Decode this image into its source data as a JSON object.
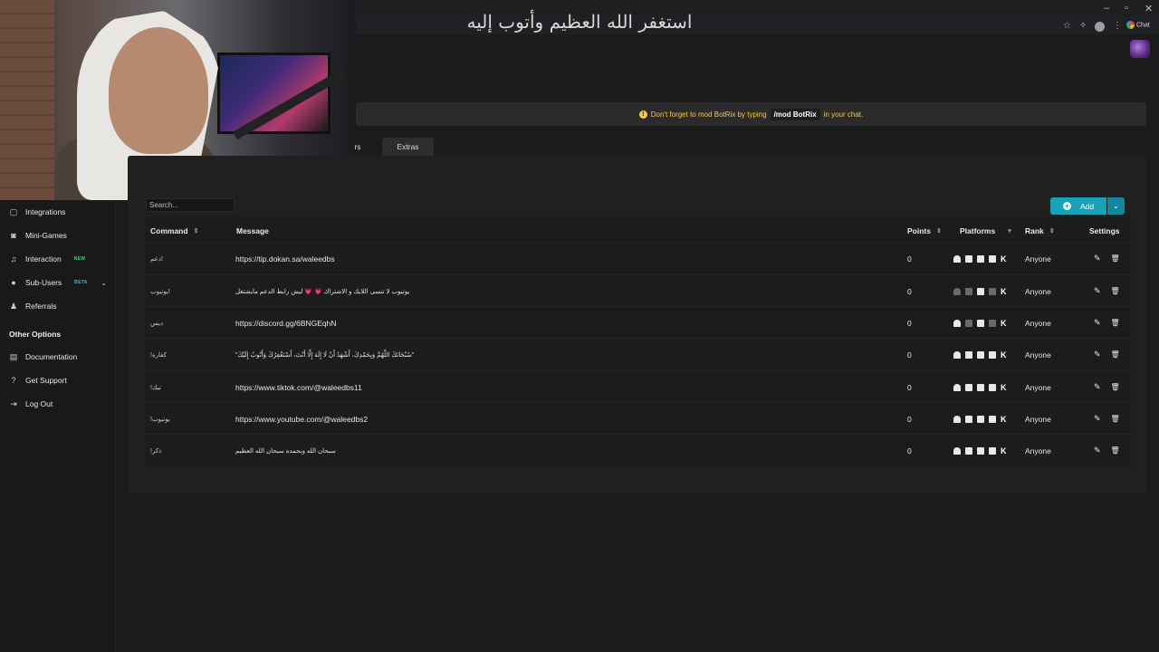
{
  "overlay_text": "استغفر الله العظيم وأتوب إليه",
  "browser": {
    "window_controls": [
      "–",
      "▫",
      "✕"
    ],
    "chat_label": "Chat"
  },
  "sidebar": {
    "items": [
      {
        "label": "Integrations",
        "icon": "integrations-icon",
        "glyph": "▢",
        "top": 0
      },
      {
        "label": "Mini-Games",
        "icon": "gamepad-icon",
        "glyph": "◙"
      },
      {
        "label": "Interaction",
        "icon": "music-note-icon",
        "glyph": "♫",
        "badge": "NEW"
      },
      {
        "label": "Sub-Users",
        "icon": "users-icon",
        "glyph": "●",
        "badge": "BETA"
      },
      {
        "label": "Referrals",
        "icon": "referrals-icon",
        "glyph": "♟"
      }
    ],
    "other_options_title": "Other Options",
    "other_items": [
      {
        "label": "Documentation",
        "icon": "book-icon",
        "glyph": "▤"
      },
      {
        "label": "Get Support",
        "icon": "question-icon",
        "glyph": "?"
      },
      {
        "label": "Log Out",
        "icon": "logout-icon",
        "glyph": "⇥"
      }
    ]
  },
  "notice": {
    "icon": "!",
    "prefix": "Don't forget to mod BotRix by typing",
    "code": "/mod BotRix",
    "suffix": "in your chat."
  },
  "tabs": {
    "partial_label": "rs",
    "extras_label": "Extras"
  },
  "search": {
    "placeholder": "Search..."
  },
  "add_button": {
    "label": "Add",
    "dropdown": "⌄"
  },
  "table": {
    "headers": {
      "command": "Command",
      "message": "Message",
      "points": "Points",
      "platforms": "Platforms",
      "rank": "Rank",
      "settings": "Settings"
    },
    "rows": [
      {
        "command": "دعم!",
        "message": "https://tip.dokan.sa/waleedbs",
        "points": "0",
        "rank": "Anyone",
        "ar": false
      },
      {
        "command": "يوتيوب!",
        "message": "يوتيوب لا تنسى اللايك و الاشتراك 💗 💗 ليش رابط الدعم مايشتغل",
        "points": "0",
        "rank": "Anyone",
        "ar": true
      },
      {
        "command": "ديس",
        "message": "https://discord.gg/6BNGEqhN",
        "points": "0",
        "rank": "Anyone",
        "ar": false
      },
      {
        "command": "!كفاره",
        "message": "\"سُبْحَانَكَ اللَّهُمَّ وَبِحَمْدِكَ، أَشْهَدُ أَنْ لَا إِلَهَ إِلَّا أَنْتَ، أَسْتَغْفِرُكَ وَأَتُوبُ إِلَيْكَ\"",
        "points": "0",
        "rank": "Anyone",
        "ar": true
      },
      {
        "command": "!تيك",
        "message": "https://www.tiktok.com/@waleedbs11",
        "points": "0",
        "rank": "Anyone",
        "ar": false
      },
      {
        "command": "!يوتيوب",
        "message": "https://www.youtube.com/@waleedbs2",
        "points": "0",
        "rank": "Anyone",
        "ar": false
      },
      {
        "command": "!ذكر",
        "message": "سبحان الله وبحمده سبحان الله العظيم",
        "points": "0",
        "rank": "Anyone",
        "ar": true
      }
    ]
  },
  "icons": {
    "edit": "✎",
    "delete": "🗑",
    "filter": "▾",
    "sort": "⇕",
    "kick": "K"
  }
}
